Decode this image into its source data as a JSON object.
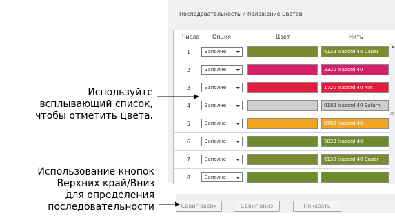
{
  "panel": {
    "title": "Последовательность и положение цветов",
    "columns": [
      "Число",
      "Опция",
      "Цвет",
      "Нить"
    ]
  },
  "rows": [
    {
      "num": "1",
      "option": "Заполне",
      "color": "#7d8a2f",
      "thread": "6133 Isacord 40 Caper",
      "thread_text_color": "#ffffff"
    },
    {
      "num": "2",
      "option": "Заполне",
      "color": "#d61f6a",
      "thread": "2320 Isacord 40",
      "thread_text_color": "#ffffff"
    },
    {
      "num": "3",
      "option": "Заполне",
      "color": "#e31b3c",
      "thread": "1720 Isacord 40 Not",
      "thread_text_color": "#ffffff"
    },
    {
      "num": "4",
      "option": "Заполне",
      "color": "#cfcfcf",
      "thread": "0182 Isacord 40 Saturn",
      "thread_text_color": "#333333"
    },
    {
      "num": "5",
      "option": "Заполне",
      "color": "#f2a51f",
      "thread": "0702 Isacord 40",
      "thread_text_color": "#ffffff"
    },
    {
      "num": "6",
      "option": "Заполне",
      "color": "#6f8a2a",
      "thread": "5833 Isacord 40",
      "thread_text_color": "#ffffff"
    },
    {
      "num": "7",
      "option": "Заполне",
      "color": "#7d8a2f",
      "thread": "6133 Isacord 40 Caper",
      "thread_text_color": "#ffffff"
    },
    {
      "num": "8",
      "option": "Заполне",
      "color": "#6f8a2a",
      "thread": "",
      "thread_text_color": "#ffffff"
    }
  ],
  "buttons": {
    "move_up": "Сдвиг вверх",
    "move_down": "Сдвиг вниз",
    "show": "Показать"
  },
  "annotations": {
    "dropdown": [
      "Используйте",
      "всплывающий список,",
      "чтобы отметить цвета."
    ],
    "buttons": [
      "Использование кнопок",
      "Верхних край/Вниз",
      "для определения",
      "последовательности"
    ]
  },
  "icons": {
    "dropdown_arrow": "chevron-down-icon",
    "scroll_up": "arrow-up-icon"
  }
}
